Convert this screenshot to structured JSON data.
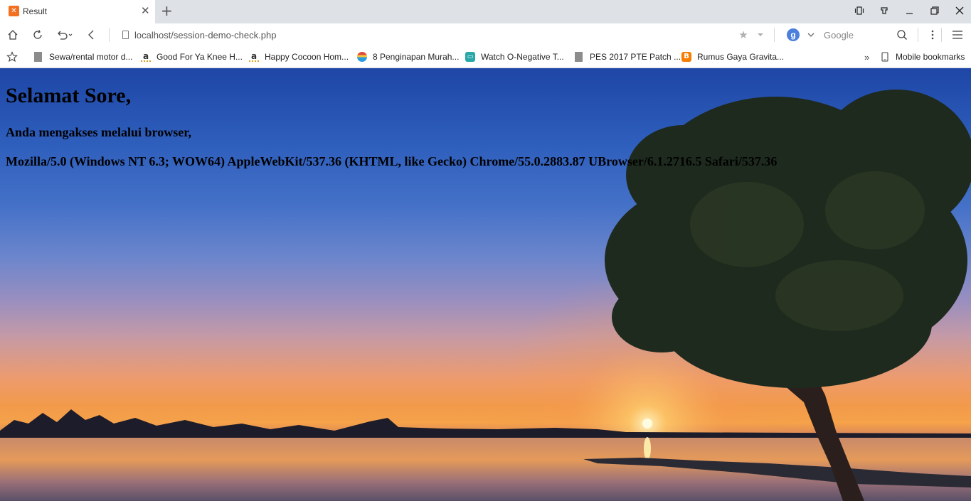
{
  "tab": {
    "title": "Result",
    "favicon": "xampp-icon"
  },
  "window": {
    "controls": [
      "tablet-mode-icon",
      "extension-icon",
      "minimize-icon",
      "restore-icon",
      "close-icon"
    ]
  },
  "toolbar": {
    "url": "localhost/session-demo-check.php",
    "search_engine_letter": "g",
    "search_placeholder": "Google"
  },
  "bookmarks": {
    "items": [
      {
        "label": "Sewa/rental motor d...",
        "icon": "page-icon"
      },
      {
        "label": "Good For Ya Knee H...",
        "icon": "amazon-icon"
      },
      {
        "label": "Happy Cocoon Hom...",
        "icon": "amazon-icon"
      },
      {
        "label": "8 Penginapan Murah...",
        "icon": "travel-icon"
      },
      {
        "label": "Watch O-Negative T...",
        "icon": "tv-icon"
      },
      {
        "label": "PES 2017 PTE Patch ...",
        "icon": "page-icon"
      },
      {
        "label": "Rumus Gaya Gravita...",
        "icon": "blogger-icon"
      }
    ],
    "overflow": "»",
    "mobile_label": "Mobile bookmarks"
  },
  "page": {
    "greeting": "Selamat Sore,",
    "intro": "Anda mengakses melalui browser,",
    "user_agent": "Mozilla/5.0 (Windows NT 6.3; WOW64) AppleWebKit/537.36 (KHTML, like Gecko) Chrome/55.0.2883.87 UBrowser/6.1.2716.5 Safari/537.36"
  },
  "colors": {
    "tabstrip": "#dee1e6",
    "accent": "#4a7fdb",
    "sky_top": "#1e46a6",
    "sunset": "#f29a4a"
  }
}
